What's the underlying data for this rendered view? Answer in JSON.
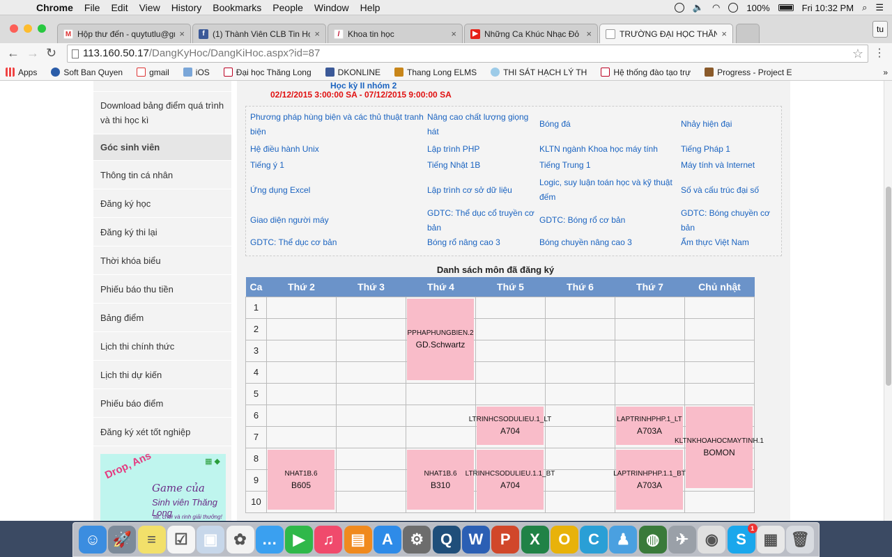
{
  "menubar": {
    "app": "Chrome",
    "items": [
      "File",
      "Edit",
      "View",
      "History",
      "Bookmarks",
      "People",
      "Window",
      "Help"
    ],
    "battery": "100%",
    "clock": "Fri 10:32 PM"
  },
  "tabs": [
    {
      "label": "Hộp thư đến - quytutlu@gm",
      "icon": "gmail-icon"
    },
    {
      "label": "(1) Thành Viên CLB Tin Học",
      "icon": "facebook-icon"
    },
    {
      "label": "Khoa tin học",
      "icon": "thang-long-icon"
    },
    {
      "label": "Những Ca Khúc Nhạc Đỏ H",
      "icon": "youtube-icon"
    },
    {
      "label": "TRƯỜNG ĐẠI HỌC THĂNG",
      "icon": "page-icon"
    }
  ],
  "profile_label": "tu",
  "address": {
    "host": "113.160.50.17",
    "path": "/DangKyHoc/DangKiHoc.aspx?id=87"
  },
  "bookmarks": [
    {
      "label": "Apps",
      "icon": "apps-grid-icon"
    },
    {
      "label": "Soft Ban Quyen",
      "icon": "globe-icon"
    },
    {
      "label": "gmail",
      "icon": "gmail-icon"
    },
    {
      "label": "iOS",
      "icon": "folder-icon"
    },
    {
      "label": "Đại học Thăng Long",
      "icon": "thang-long-icon"
    },
    {
      "label": "DKONLINE",
      "icon": "facebook-icon"
    },
    {
      "label": "Thang Long ELMS",
      "icon": "elms-icon"
    },
    {
      "label": "THI SÁT HẠCH LÝ TH",
      "icon": "cloud-icon"
    },
    {
      "label": "Hệ thống đào tạo trự",
      "icon": "thang-long-icon"
    },
    {
      "label": "Progress - Project E",
      "icon": "progress-icon"
    }
  ],
  "sidebar": {
    "items": [
      {
        "label": "Download bảng điểm quá trình và thi học kì",
        "head": false
      },
      {
        "label": "Góc sinh viên",
        "head": true
      },
      {
        "label": "Thông tin cá nhân",
        "head": false
      },
      {
        "label": "Đăng ký học",
        "head": false
      },
      {
        "label": "Đăng ký thi lại",
        "head": false
      },
      {
        "label": "Thời khóa biểu",
        "head": false
      },
      {
        "label": "Phiếu báo thu tiền",
        "head": false
      },
      {
        "label": "Bảng điểm",
        "head": false
      },
      {
        "label": "Lịch thi chính thức",
        "head": false
      },
      {
        "label": "Lịch thi dự kiến",
        "head": false
      },
      {
        "label": "Phiếu báo điểm",
        "head": false
      },
      {
        "label": "Đăng ký xét tốt nghiệp",
        "head": false
      }
    ],
    "banner": {
      "logo": "Drop, Ans",
      "line1": "Game của",
      "line2": "Sinh viên Thăng Long",
      "line3": "tải, chơi và rinh giải thưởng!"
    }
  },
  "semester": {
    "title": "Học kỳ II nhóm 2",
    "range": "02/12/2015 3:00:00 SA - 07/12/2015 9:00:00 SA"
  },
  "courses": [
    "Phương pháp hùng biện và các thủ thuật tranh biện",
    "Nâng cao chất lượng giọng hát",
    "Bóng đá",
    "Nhảy hiện đại",
    "Hệ điều hành Unix",
    "Lập trình PHP",
    "KLTN ngành Khoa học máy tính",
    "Tiếng Pháp 1",
    "Tiếng ý 1",
    "Tiếng Nhật 1B",
    "Tiếng Trung 1",
    "Máy tính và Internet",
    "Ứng dụng Excel",
    "Lập trình cơ sở dữ liệu",
    "Logic, suy luận toán học và kỹ thuật đếm",
    "Số và cấu trúc đại số",
    "Giao diện người máy",
    "GDTC: Thể dục cổ truyền cơ bản",
    "GDTC: Bóng rổ cơ bản",
    "GDTC: Bóng chuyền cơ bản",
    "GDTC: Thể dục cơ bản",
    "Bóng rổ nâng cao 3",
    "Bóng chuyền nâng cao 3",
    "Ẩm thực Việt Nam"
  ],
  "schedule": {
    "title": "Danh sách môn đã đăng ký",
    "headers": [
      "Ca",
      "Thứ 2",
      "Thứ 3",
      "Thứ 4",
      "Thứ 5",
      "Thứ 6",
      "Thứ 7",
      "Chủ nhật"
    ],
    "periods": [
      "1",
      "2",
      "3",
      "4",
      "5",
      "6",
      "7",
      "8",
      "9",
      "10"
    ],
    "blocks": [
      {
        "day": 2,
        "start": 1,
        "span": 4,
        "code": "PPHAPHUNGBIEN.2",
        "room": "GD.Schwartz"
      },
      {
        "day": 3,
        "start": 6,
        "span": 2,
        "code": "LTRINHCSODULIEU.1_LT",
        "room": "A704"
      },
      {
        "day": 5,
        "start": 6,
        "span": 2,
        "code": "LAPTRINHPHP.1_LT",
        "room": "A703A"
      },
      {
        "day": 6,
        "start": 6,
        "span": 4,
        "code": "KLTNKHOAHOCMAYTINH.1",
        "room": "BOMON"
      },
      {
        "day": 0,
        "start": 8,
        "span": 3,
        "code": "NHAT1B.6",
        "room": "B605"
      },
      {
        "day": 2,
        "start": 8,
        "span": 3,
        "code": "NHAT1B.6",
        "room": "B310"
      },
      {
        "day": 3,
        "start": 8,
        "span": 3,
        "code": "LTRINHCSODULIEU.1.1_BT",
        "room": "A704"
      },
      {
        "day": 5,
        "start": 8,
        "span": 3,
        "code": "LAPTRINHPHP.1.1_BT",
        "room": "A703A"
      }
    ]
  },
  "dock": [
    {
      "name": "finder",
      "color": "#3b8de0",
      "glyph": "☺"
    },
    {
      "name": "launchpad",
      "color": "#7c8a99",
      "glyph": "🚀"
    },
    {
      "name": "notes",
      "color": "#f2e06a",
      "glyph": "≡"
    },
    {
      "name": "reminders",
      "color": "#f5f5f5",
      "glyph": "☑"
    },
    {
      "name": "preview",
      "color": "#c7d7ea",
      "glyph": "▣"
    },
    {
      "name": "photos",
      "color": "#f2f2f2",
      "glyph": "✿"
    },
    {
      "name": "messages",
      "color": "#3aa0f0",
      "glyph": "…"
    },
    {
      "name": "facetime",
      "color": "#2fb84a",
      "glyph": "▶"
    },
    {
      "name": "itunes",
      "color": "#f04a6c",
      "glyph": "♫"
    },
    {
      "name": "ibooks",
      "color": "#f08a1e",
      "glyph": "▤"
    },
    {
      "name": "app-store",
      "color": "#2e8be8",
      "glyph": "A"
    },
    {
      "name": "system-preferences",
      "color": "#6d6d6d",
      "glyph": "⚙"
    },
    {
      "name": "quicktime",
      "color": "#1f4e7a",
      "glyph": "Q"
    },
    {
      "name": "word",
      "color": "#2b5fb4",
      "glyph": "W"
    },
    {
      "name": "powerpoint",
      "color": "#d1472a",
      "glyph": "P"
    },
    {
      "name": "excel",
      "color": "#208246",
      "glyph": "X"
    },
    {
      "name": "outlook",
      "color": "#e8b20a",
      "glyph": "O"
    },
    {
      "name": "c-app",
      "color": "#2a9fd6",
      "glyph": "C"
    },
    {
      "name": "people-app",
      "color": "#4aa0e0",
      "glyph": "♟"
    },
    {
      "name": "network-app",
      "color": "#3a7a3a",
      "glyph": "◍"
    },
    {
      "name": "satellite-app",
      "color": "#9aa0a8",
      "glyph": "✈"
    },
    {
      "name": "chrome",
      "color": "#e0e0e0",
      "glyph": "◉"
    },
    {
      "name": "skype",
      "color": "#1aa7ec",
      "glyph": "S",
      "badge": "1"
    },
    {
      "name": "documents",
      "color": "#e8e8e8",
      "glyph": "▦"
    },
    {
      "name": "trash",
      "color": "#d8dbe0",
      "glyph": "🗑"
    }
  ]
}
